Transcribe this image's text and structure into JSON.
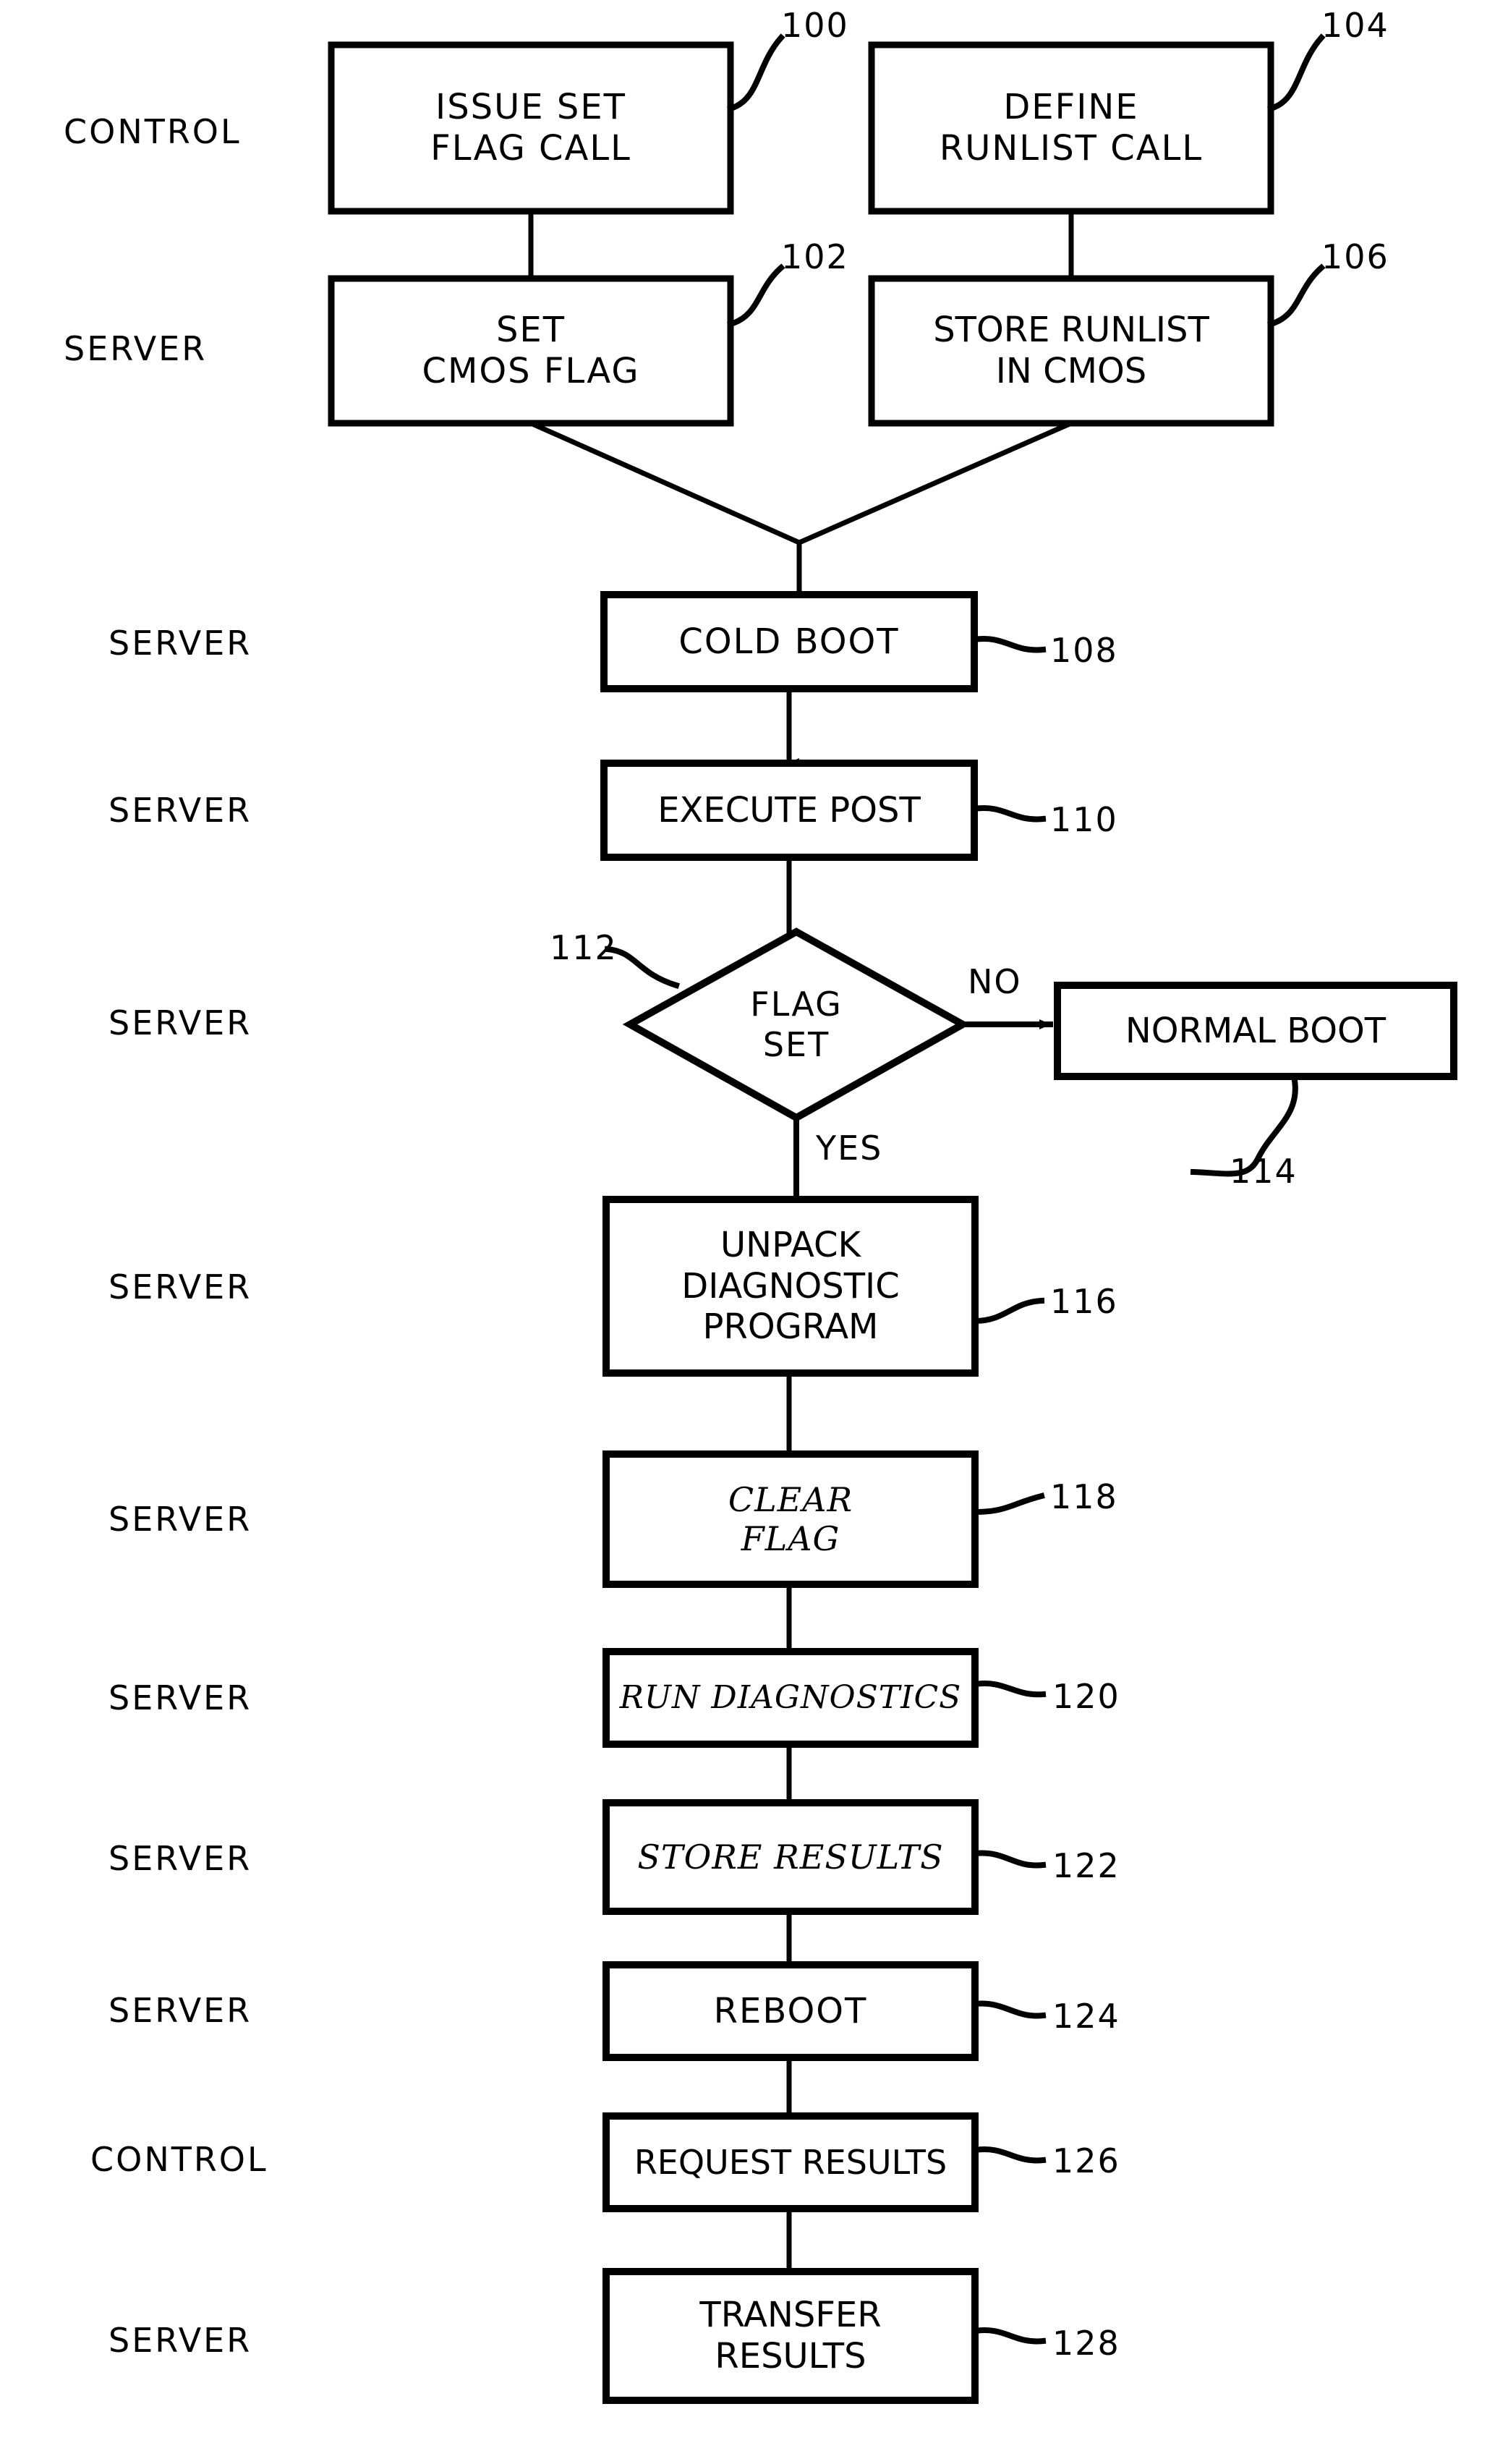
{
  "figure": {
    "type": "patent-flowchart",
    "row_labels": [
      {
        "id": "row-1",
        "text": "CONTROL"
      },
      {
        "id": "row-2",
        "text": "SERVER"
      },
      {
        "id": "row-3",
        "text": "SERVER"
      },
      {
        "id": "row-4",
        "text": "SERVER"
      },
      {
        "id": "row-5",
        "text": "SERVER"
      },
      {
        "id": "row-6",
        "text": "SERVER"
      },
      {
        "id": "row-7",
        "text": "SERVER"
      },
      {
        "id": "row-8",
        "text": "SERVER"
      },
      {
        "id": "row-9",
        "text": "SERVER"
      },
      {
        "id": "row-10",
        "text": "SERVER"
      },
      {
        "id": "row-11",
        "text": "CONTROL"
      },
      {
        "id": "row-12",
        "text": "SERVER"
      }
    ],
    "nodes": [
      {
        "id": "n100",
        "ref": "100",
        "shape": "rect",
        "lines": [
          "ISSUE  SET",
          "FLAG CALL"
        ]
      },
      {
        "id": "n104",
        "ref": "104",
        "shape": "rect",
        "lines": [
          "DEFINE",
          "RUNLIST  CALL"
        ]
      },
      {
        "id": "n102",
        "ref": "102",
        "shape": "rect",
        "lines": [
          "SET",
          "CMOS  FLAG"
        ]
      },
      {
        "id": "n106",
        "ref": "106",
        "shape": "rect",
        "lines": [
          "STORE RUNLIST",
          "IN CMOS"
        ]
      },
      {
        "id": "n108",
        "ref": "108",
        "shape": "rect",
        "lines": [
          "COLD BOOT"
        ]
      },
      {
        "id": "n110",
        "ref": "110",
        "shape": "rect",
        "lines": [
          "EXECUTE POST"
        ]
      },
      {
        "id": "n112",
        "ref": "112",
        "shape": "diamond",
        "lines": [
          "FLAG",
          "SET"
        ]
      },
      {
        "id": "n114",
        "ref": "114",
        "shape": "rect",
        "lines": [
          "NORMAL BOOT"
        ]
      },
      {
        "id": "n116",
        "ref": "116",
        "shape": "rect",
        "lines": [
          "UNPACK",
          "DIAGNOSTIC",
          "PROGRAM"
        ]
      },
      {
        "id": "n118",
        "ref": "118",
        "shape": "rect",
        "lines": [
          "CLEAR",
          "FLAG"
        ]
      },
      {
        "id": "n120",
        "ref": "120",
        "shape": "rect",
        "lines": [
          "RUN DIAGNOSTICS"
        ]
      },
      {
        "id": "n122",
        "ref": "122",
        "shape": "rect",
        "lines": [
          "STORE RESULTS"
        ]
      },
      {
        "id": "n124",
        "ref": "124",
        "shape": "rect",
        "lines": [
          "REBOOT"
        ]
      },
      {
        "id": "n126",
        "ref": "126",
        "shape": "rect",
        "lines": [
          "REQUEST RESULTS"
        ]
      },
      {
        "id": "n128",
        "ref": "128",
        "shape": "rect",
        "lines": [
          "TRANSFER",
          "RESULTS"
        ]
      }
    ],
    "branch_labels": [
      {
        "id": "branch-no",
        "text": "NO"
      },
      {
        "id": "branch-yes",
        "text": "YES"
      }
    ],
    "colors": {
      "ink": "#000000",
      "paper": "#ffffff"
    }
  }
}
